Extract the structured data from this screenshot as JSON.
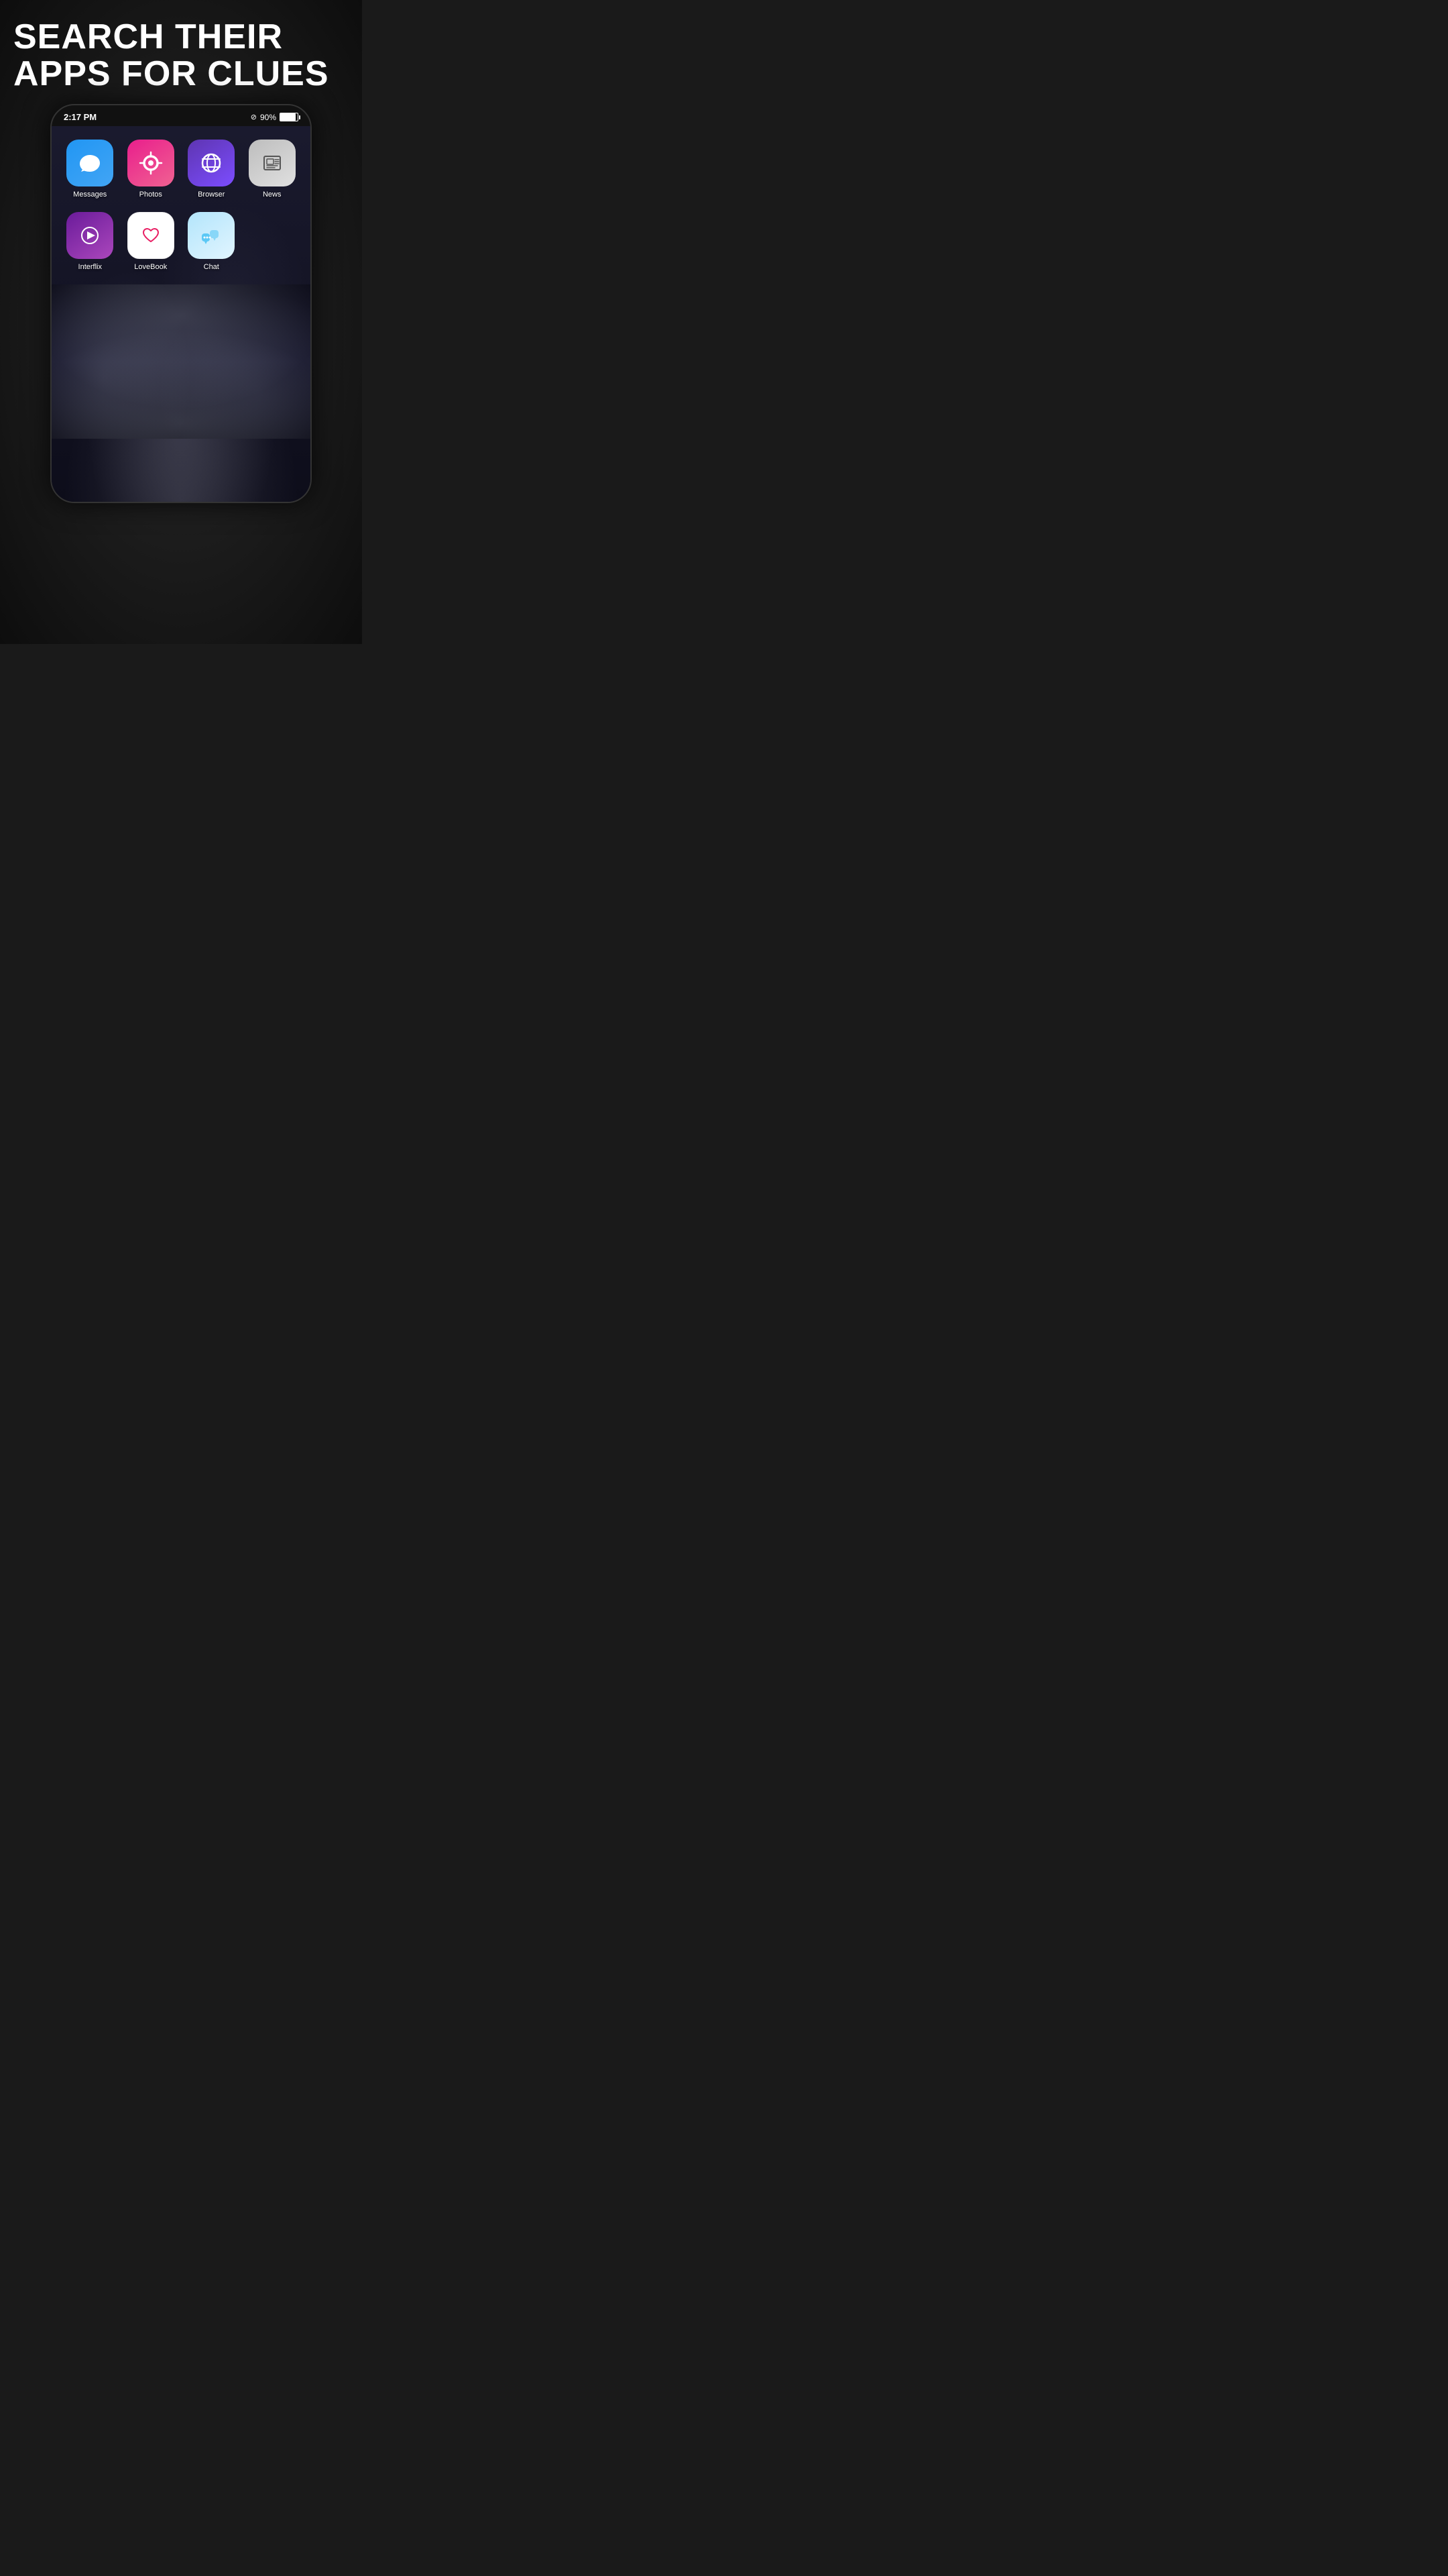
{
  "headline": {
    "line1": "SEARCH THEIR",
    "line2": "APPS FOR CLUES"
  },
  "status_bar": {
    "time": "2:17 PM",
    "signal_icon": "⊘",
    "battery_percent": "90%"
  },
  "apps_row1": [
    {
      "id": "messages",
      "label": "Messages",
      "icon_type": "messages",
      "color": "blue"
    },
    {
      "id": "photos",
      "label": "Photos",
      "icon_type": "photos",
      "color": "pink"
    },
    {
      "id": "browser",
      "label": "Browser",
      "icon_type": "browser",
      "color": "purple"
    },
    {
      "id": "news",
      "label": "News",
      "icon_type": "news",
      "color": "gray"
    }
  ],
  "apps_row2": [
    {
      "id": "interflix",
      "label": "Interflix",
      "icon_type": "interflix",
      "color": "purple"
    },
    {
      "id": "lovebook",
      "label": "LoveBook",
      "icon_type": "lovebook",
      "color": "white"
    },
    {
      "id": "chat",
      "label": "Chat",
      "icon_type": "chat",
      "color": "lightblue"
    }
  ]
}
